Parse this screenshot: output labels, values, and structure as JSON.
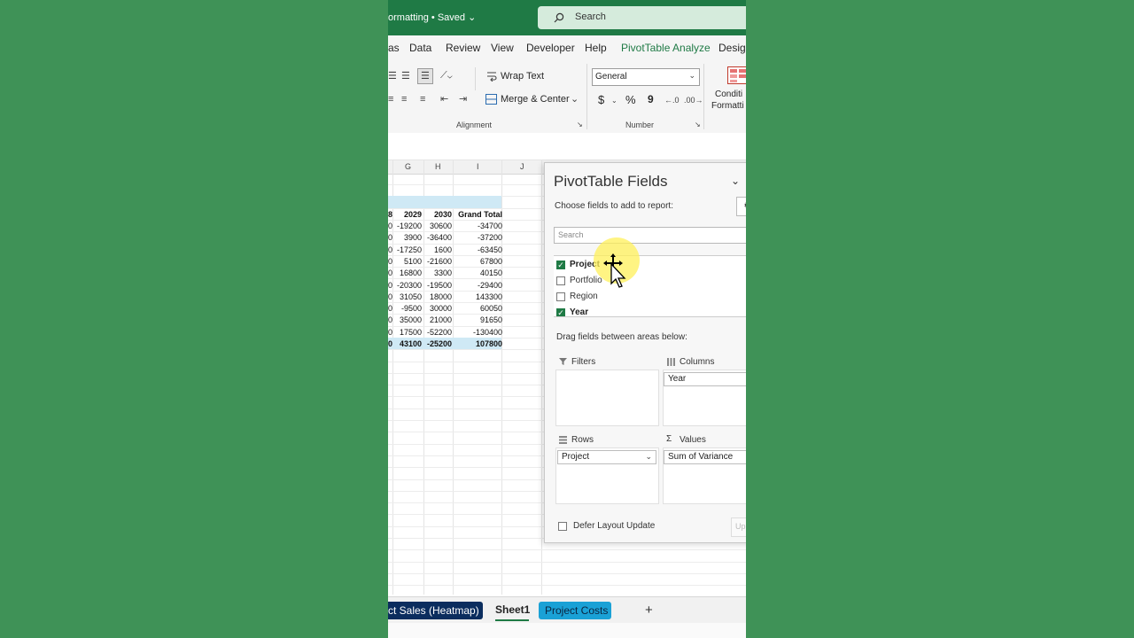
{
  "title_bar": {
    "doc_title": "ormatting • Saved",
    "search_placeholder": "Search"
  },
  "menu": [
    "as",
    "Data",
    "Review",
    "View",
    "Developer",
    "Help",
    "PivotTable Analyze",
    "Design"
  ],
  "ribbon": {
    "wrap_text": "Wrap Text",
    "merge_center": "Merge & Center",
    "alignment_label": "Alignment",
    "number_format": "General",
    "number_label": "Number",
    "conditional_line1": "Conditi",
    "conditional_line2": "Formatti",
    "currency": "$",
    "percent": "%",
    "comma": "9"
  },
  "grid": {
    "columns": [
      "G",
      "H",
      "I",
      "J"
    ],
    "header": {
      "col_f": "8",
      "col_g": "2029",
      "col_h": "2030",
      "col_i": "Grand Total"
    },
    "rows": [
      {
        "f": "0",
        "g": "-19200",
        "h": "30600",
        "i": "-34700"
      },
      {
        "f": "0",
        "g": "3900",
        "h": "-36400",
        "i": "-37200"
      },
      {
        "f": "0",
        "g": "-17250",
        "h": "1600",
        "i": "-63450"
      },
      {
        "f": "0",
        "g": "5100",
        "h": "-21600",
        "i": "67800"
      },
      {
        "f": "0",
        "g": "16800",
        "h": "3300",
        "i": "40150"
      },
      {
        "f": "0",
        "g": "-20300",
        "h": "-19500",
        "i": "-29400"
      },
      {
        "f": "0",
        "g": "31050",
        "h": "18000",
        "i": "143300"
      },
      {
        "f": "0",
        "g": "-9500",
        "h": "30000",
        "i": "60050"
      },
      {
        "f": "0",
        "g": "35000",
        "h": "21000",
        "i": "91650"
      },
      {
        "f": "0",
        "g": "17500",
        "h": "-52200",
        "i": "-130400"
      }
    ],
    "total": {
      "f": "0",
      "g": "43100",
      "h": "-25200",
      "i": "107800"
    }
  },
  "pivot_pane": {
    "title": "PivotTable Fields",
    "choose_label": "Choose fields to add to report:",
    "search_placeholder": "Search",
    "fields": [
      {
        "name": "Project",
        "checked": true
      },
      {
        "name": "Portfolio",
        "checked": false
      },
      {
        "name": "Region",
        "checked": false
      },
      {
        "name": "Year",
        "checked": true
      }
    ],
    "drag_label": "Drag fields between areas below:",
    "areas": {
      "filters": {
        "label": "Filters"
      },
      "columns": {
        "label": "Columns",
        "item": "Year"
      },
      "rows": {
        "label": "Rows",
        "item": "Project"
      },
      "values": {
        "label": "Values",
        "item": "Sum of Variance"
      }
    },
    "defer_label": "Defer Layout Update",
    "update_label": "Up"
  },
  "sheet_tabs": [
    "ct Sales (Heatmap)",
    "Sheet1",
    "Project Costs"
  ],
  "add_sheet": "+",
  "colors": {
    "excel_green": "#1f7a45",
    "background_green": "#3f9257",
    "pivot_band": "#cfe9f5"
  },
  "icons": [
    "search-icon",
    "wrap-text-icon",
    "merge-icon",
    "filter-icon",
    "columns-icon",
    "rows-icon",
    "sigma-icon",
    "move-cursor-icon"
  ]
}
